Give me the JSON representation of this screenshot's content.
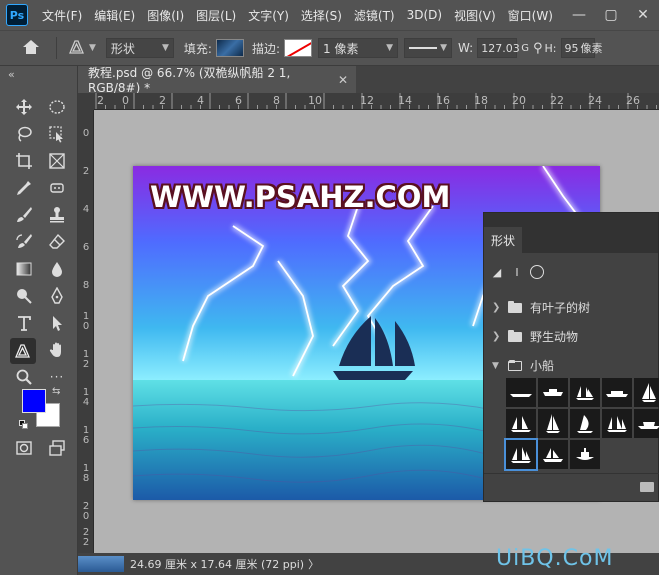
{
  "app": {
    "logo": "Ps"
  },
  "menu": [
    "文件(F)",
    "编辑(E)",
    "图像(I)",
    "图层(L)",
    "文字(Y)",
    "选择(S)",
    "滤镜(T)",
    "3D(D)",
    "视图(V)",
    "窗口(W)",
    "帮"
  ],
  "window_controls": {
    "minimize": "—",
    "restore": "▢",
    "close": "✕"
  },
  "options": {
    "mode": "形状",
    "fill_label": "填充:",
    "stroke_label": "描边:",
    "stroke_width": "1 像素",
    "w_label": "W:",
    "w_value": "127.03",
    "g_label": "G",
    "h_label": "H:",
    "h_value": "95",
    "h_unit": "像素"
  },
  "document_tab": {
    "title": "教程.psd @ 66.7% (双桅纵帆船 2 1, RGB/8#) *",
    "close": "✕"
  },
  "ruler_top": [
    "2",
    "0",
    "2",
    "4",
    "6",
    "8",
    "10",
    "12",
    "14",
    "16",
    "18",
    "20",
    "22",
    "24",
    "26"
  ],
  "ruler_left": [
    "0",
    "2",
    "4",
    "6",
    "8",
    "1\n0",
    "1\n2",
    "1\n4",
    "1\n6",
    "1\n8",
    "2\n0",
    "2\n2",
    "2\n4"
  ],
  "artwork": {
    "watermark": "WWW.PSAHZ.COM"
  },
  "shapes_panel": {
    "tab": "形状",
    "groups": [
      {
        "name": "有叶子的树",
        "expanded": false
      },
      {
        "name": "野生动物",
        "expanded": false
      },
      {
        "name": "小船",
        "expanded": true
      }
    ]
  },
  "statusbar": {
    "dimensions": "24.69 厘米 x 17.64 厘米 (72 ppi)",
    "arrow": "〉"
  },
  "site_mark": "UiBQ.CoM",
  "colors": {
    "foreground": "#0000ff",
    "background": "#ffffff"
  }
}
